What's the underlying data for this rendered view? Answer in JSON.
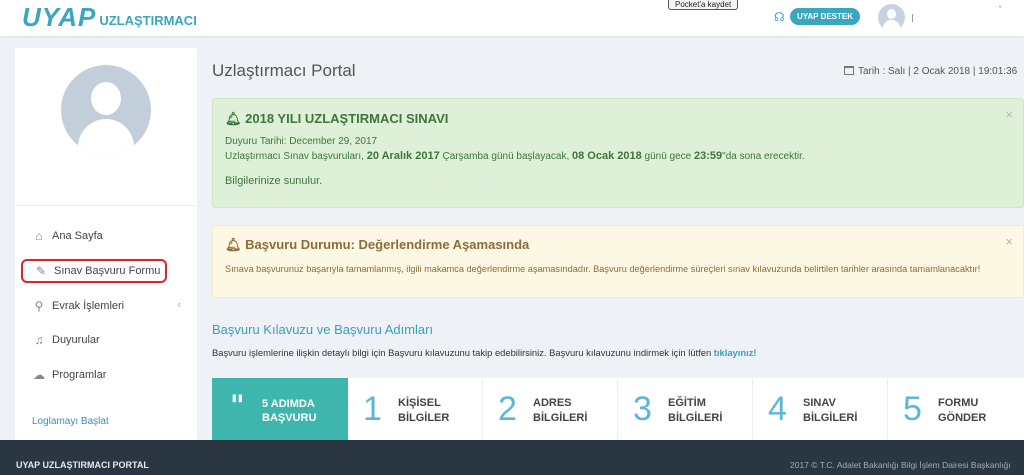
{
  "header": {
    "logo_main": "UYAP",
    "logo_sub": "UZLAŞTIRMACI",
    "pocket_label": "Pocket'a kaydet",
    "support_label": "UYAP DESTEK",
    "user_caret": "ˇ"
  },
  "sidebar": {
    "items": [
      {
        "label": "Ana Sayfa",
        "icon": "home-icon",
        "glyph": "⌂"
      },
      {
        "label": "Sınav Başvuru Formu",
        "icon": "pencil-icon",
        "glyph": "✎"
      },
      {
        "label": "Evrak İşlemleri",
        "icon": "paperclip-icon",
        "glyph": "⚲"
      },
      {
        "label": "Duyurular",
        "icon": "bell-icon",
        "glyph": "♫"
      },
      {
        "label": "Programlar",
        "icon": "cloud-icon",
        "glyph": "☁"
      }
    ],
    "submenu_caret": "‹",
    "log_link": "Loglamayı Başlat"
  },
  "main": {
    "page_title": "Uzlaştırmacı Portal",
    "date_label": "Tarih : Salı | 2 Ocak 2018 | 19:01:36"
  },
  "announcement": {
    "title": "2018 YILI UZLAŞTIRMACI SINAVI",
    "date_line": "Duyuru Tarihi: December 29, 2017",
    "body_p1": "Uzlaştırmacı Sınav başvuruları, ",
    "body_b1": "20 Aralık 2017",
    "body_p2": " Çarşamba günü başlayacak, ",
    "body_b2": "08 Ocak 2018",
    "body_p3": " günü gece ",
    "body_b3": "23:59",
    "body_p4": "\"da sona erecektir.",
    "closing": "Bilgilerinize sunulur.",
    "close": "×"
  },
  "status": {
    "title": "Başvuru Durumu: Değerlendirme Aşamasında",
    "text": "Sınava başvurunuz başarıyla tamamlanmış, ilgili makamca değerlendirme aşamasındadır. Başvuru değerlendirme süreçleri sınav kılavuzunda belirtilen tarihler arasında tamamlanacaktır!",
    "close": "×"
  },
  "guide": {
    "title": "Başvuru Kılavuzu ve Başvuru Adımları",
    "desc": "Başvuru işlemlerine ilişkin detaylı bilgi için Başvuru kılavuzunu takip edebilirsiniz. Başvuru kılavuzunu indirmek için lütfen ",
    "link": "tıklayınız!"
  },
  "steps": {
    "first_line1": "5 ADIMDA",
    "first_line2": "BAŞVURU",
    "first_glyph": "\"",
    "items": [
      {
        "num": "1",
        "line1": "KİŞİSEL",
        "line2": "BİLGİLER"
      },
      {
        "num": "2",
        "line1": "ADRES",
        "line2": "BİLGİLERİ"
      },
      {
        "num": "3",
        "line1": "EĞİTİM",
        "line2": "BİLGİLERİ"
      },
      {
        "num": "4",
        "line1": "SINAV",
        "line2": "BİLGİLERİ"
      },
      {
        "num": "5",
        "line1": "FORMU",
        "line2": "GÖNDER"
      }
    ]
  },
  "footer": {
    "left": "UYAP UZLAŞTIRMACI PORTAL",
    "right": "2017 © T.C. Adalet Bakanlığı Bilgi İşlem Dairesi Başkanlığı"
  },
  "colors": {
    "brand": "#3aa6bf",
    "step_active": "#3fb6ad",
    "alert_success_bg": "#dff0d8",
    "alert_warning_bg": "#fcf8e3",
    "footer_bg": "#2b3643"
  }
}
